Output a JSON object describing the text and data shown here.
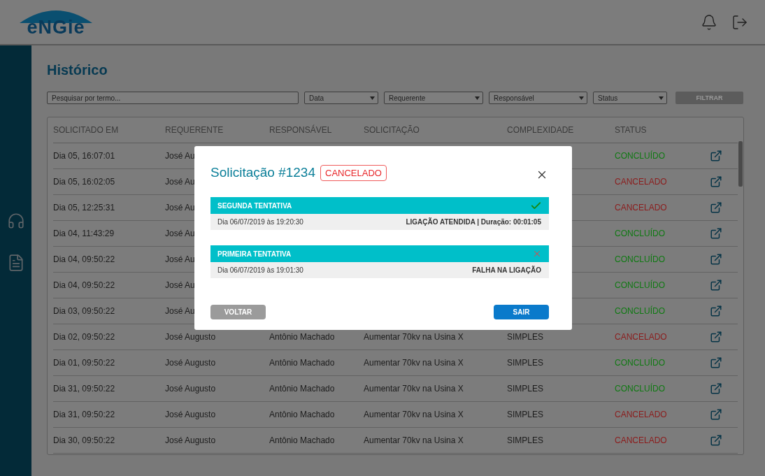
{
  "header": {
    "logo": "eNGie"
  },
  "page": {
    "title": "Histórico"
  },
  "filters": {
    "search": {
      "placeholder": "Pesquisar por termo..."
    },
    "selects": [
      "Data",
      "Requerente",
      "Responsável",
      "Status"
    ],
    "button": "FILTRAR"
  },
  "table": {
    "columns": [
      "SOLICITADO EM",
      "REQUERENTE",
      "RESPONSÁVEL",
      "SOLICITAÇÃO",
      "COMPLEXIDADE",
      "STATUS"
    ],
    "rows": [
      {
        "solicitado": "Dia 05, 16:07:01",
        "requerente": "José Au",
        "status": "CONCLUÍDO",
        "color": "#0f7a12"
      },
      {
        "solicitado": "Dia 05, 16:02:05",
        "requerente": "José Au",
        "status": "CANCELADO",
        "color": "#8c1c1c"
      },
      {
        "solicitado": "Dia 05, 12:25:31",
        "requerente": "José Au",
        "status": "CANCELADO",
        "color": "#8c1c1c"
      },
      {
        "solicitado": "Dia 04, 11:43:29",
        "requerente": "José Au",
        "status": "CONCLUÍDO",
        "color": "#0f7a12"
      },
      {
        "solicitado": "Dia 04, 09:50:22",
        "requerente": "José Au",
        "status": "CONCLUÍDO",
        "color": "#0f7a12"
      },
      {
        "solicitado": "Dia 04, 09:50:22",
        "requerente": "José Au",
        "status": "CONCLUÍDO",
        "color": "#0f7a12"
      },
      {
        "solicitado": "Dia 03, 09:50:22",
        "requerente": "José Au",
        "status": "CONCLUÍDO",
        "color": "#0f7a12"
      },
      {
        "solicitado": "Dia 02, 09:50:22",
        "requerente": "José Augusto",
        "responsavel": "Antônio Machado",
        "solicitacao": "Aumentar 70kv na Usina X",
        "complexidade": "SIMPLES",
        "status": "CANCELADO",
        "color": "#8c1c1c"
      },
      {
        "solicitado": "Dia 01, 09:50:22",
        "requerente": "José Augusto",
        "responsavel": "Antônio Machado",
        "solicitacao": "Aumentar 70kv na Usina X",
        "complexidade": "SIMPLES",
        "status": "CONCLUÍDO",
        "color": "#0f7a12"
      },
      {
        "solicitado": "Dia 31, 09:50:22",
        "requerente": "José Augusto",
        "responsavel": "Antônio Machado",
        "solicitacao": "Aumentar 70kv na Usina X",
        "complexidade": "SIMPLES",
        "status": "CONCLUÍDO",
        "color": "#0f7a12"
      },
      {
        "solicitado": "Dia 31, 09:50:22",
        "requerente": "José Augusto",
        "responsavel": "Antônio Machado",
        "solicitacao": "Aumentar 70kv na Usina X",
        "complexidade": "SIMPLES",
        "status": "CANCELADO",
        "color": "#8c1c1c"
      },
      {
        "solicitado": "Dia 30, 09:50:22",
        "requerente": "José Augusto",
        "responsavel": "Antônio Machado",
        "solicitacao": "Aumentar 70kv na Usina X",
        "complexidade": "SIMPLES",
        "status": "CANCELADO",
        "color": "#8c1c1c"
      }
    ]
  },
  "modal": {
    "title": "Solicitação #1234",
    "badge": "CANCELADO",
    "attempts": [
      {
        "title": "SEGUNDA TENTATIVA",
        "success": true,
        "date": "Dia 06/07/2019 às 19:20:30",
        "result": "LIGAÇÃO ATENDIDA | Duração: 00:01:05"
      },
      {
        "title": "PRIMEIRA TENTATIVA",
        "success": false,
        "date": "Dia 06/07/2019 às 19:01:30",
        "result": "FALHA NA LIGAÇÃO"
      }
    ],
    "buttons": [
      "VOLTAR",
      "SAIR"
    ]
  }
}
